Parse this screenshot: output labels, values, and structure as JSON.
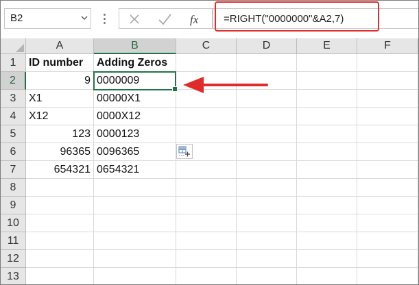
{
  "formula_bar": {
    "name_box": "B2",
    "fx_label": "fx",
    "formula": "=RIGHT(\"0000000\"&A2,7)"
  },
  "columns": [
    "A",
    "B",
    "C",
    "D",
    "E",
    "F"
  ],
  "rows": [
    "1",
    "2",
    "3",
    "4",
    "5",
    "6",
    "7",
    "8",
    "9",
    "10",
    "11",
    "12",
    "13"
  ],
  "cells": {
    "a1": "ID number",
    "b1": "Adding Zeros",
    "a2": "9",
    "b2": "0000009",
    "a3": "X1",
    "b3": "00000X1",
    "a4": "X12",
    "b4": "0000X12",
    "a5": "123",
    "b5": "0000123",
    "a6": "96365",
    "b6": "0096365",
    "a7": "654321",
    "b7": "0654321"
  },
  "colors": {
    "accent_green": "#217346",
    "annotation_red": "#e02b2b"
  },
  "icons": {
    "cancel": "x-icon",
    "enter": "check-icon",
    "function": "fx-icon",
    "quick_analysis": "quick-analysis-icon"
  }
}
